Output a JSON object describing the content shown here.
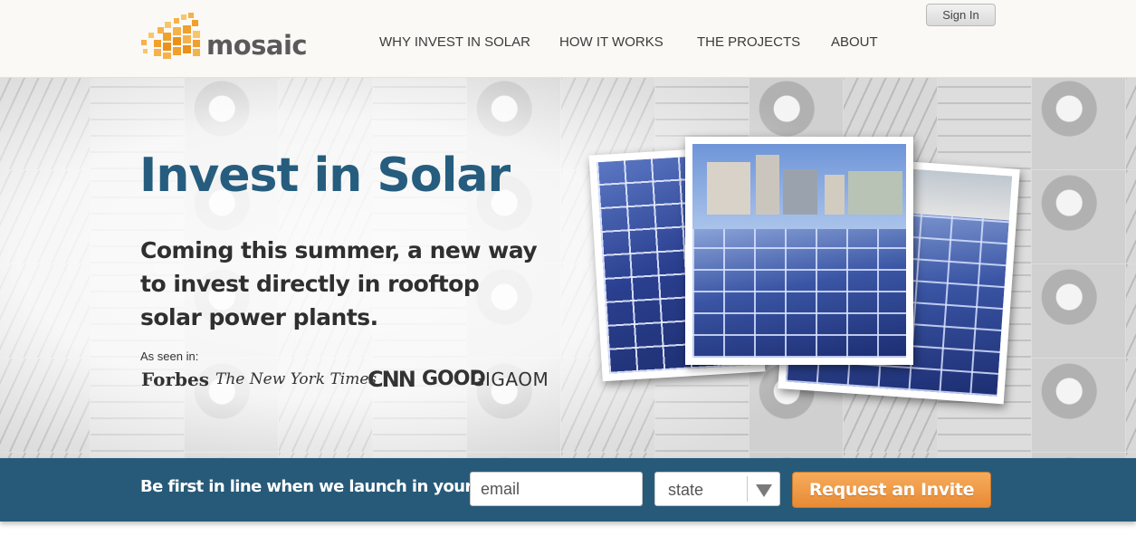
{
  "header": {
    "logo_text": "mosaic",
    "logo_icon": "mosaic-squares-logo",
    "nav": [
      {
        "label": "WHY INVEST IN SOLAR"
      },
      {
        "label": "HOW IT WORKS"
      },
      {
        "label": "THE PROJECTS"
      },
      {
        "label": "ABOUT"
      }
    ],
    "signin_label": "Sign In"
  },
  "hero": {
    "title": "Invest in Solar",
    "subtitle": "Coming this summer, a new way to invest directly in rooftop solar power plants.",
    "seen_label": "As seen in:",
    "press": [
      "Forbes",
      "The New York Times",
      "CNN",
      "GOOD",
      "GIGAOM"
    ]
  },
  "signup": {
    "prompt": "Be first in line when we launch in your state.",
    "email_placeholder": "email",
    "state_label": "state",
    "button_label": "Request an Invite"
  },
  "colors": {
    "title": "#265d7e",
    "signup_bar": "#275a78",
    "invite_button": "#ee9640",
    "logo_orange": "#f2a33a"
  }
}
